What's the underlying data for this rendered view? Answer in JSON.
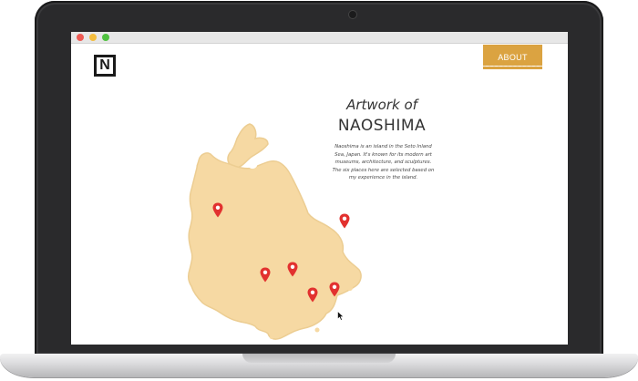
{
  "site": {
    "logo_letter": "N",
    "about_label": "ABOUT",
    "title_line1": "Artwork of",
    "title_line2": "NAOSHIMA",
    "description": "Naoshima is an island in the Seto Inland Sea, Japan. It's known for its modern art museums, architecture, and sculptures. The six places here are selected based on my experience in the island."
  },
  "map": {
    "island_color": "#f6d9a3",
    "island_edge_color": "#eccd92",
    "pin_color": "#e2312f",
    "pin_count": 6
  },
  "colors": {
    "about_button": "#dba341",
    "bezel": "#2a2a2c",
    "window_close": "#ee5a53",
    "window_minimize": "#f4bd3d",
    "window_zoom": "#4fc13f"
  }
}
